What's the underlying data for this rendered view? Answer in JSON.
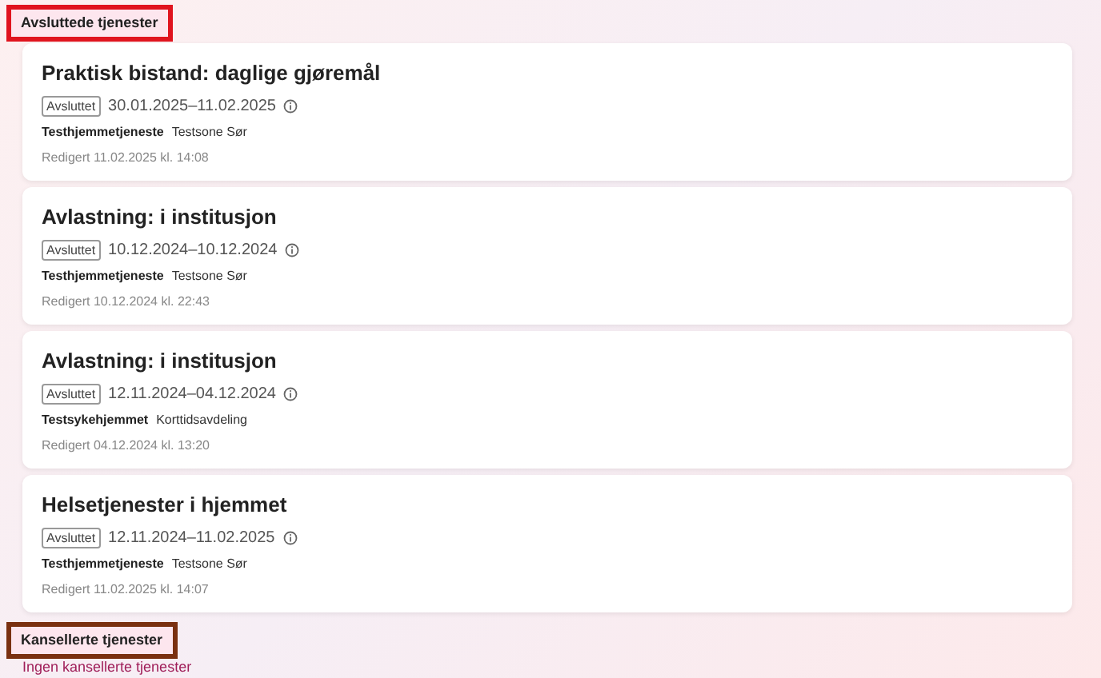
{
  "sections": [
    {
      "heading": "Avsluttede tjenester",
      "color": "#e0141e",
      "services": [
        {
          "title": "Praktisk bistand: daglige gjøremål",
          "status": "Avsluttet",
          "period": "30.01.2025–11.02.2025",
          "provider": "Testhjemmetjeneste",
          "unit": "Testsone Sør",
          "edited": "Redigert 11.02.2025 kl. 14:08"
        },
        {
          "title": "Avlastning: i institusjon",
          "status": "Avsluttet",
          "period": "10.12.2024–10.12.2024",
          "provider": "Testhjemmetjeneste",
          "unit": "Testsone Sør",
          "edited": "Redigert 10.12.2024 kl. 22:43"
        },
        {
          "title": "Avlastning: i institusjon",
          "status": "Avsluttet",
          "period": "12.11.2024–04.12.2024",
          "provider": "Testsykehjemmet",
          "unit": "Korttidsavdeling",
          "edited": "Redigert 04.12.2024 kl. 13:20"
        },
        {
          "title": "Helsetjenester i hjemmet",
          "status": "Avsluttet",
          "period": "12.11.2024–11.02.2025",
          "provider": "Testhjemmetjeneste",
          "unit": "Testsone Sør",
          "edited": "Redigert 11.02.2025 kl. 14:07"
        }
      ]
    },
    {
      "heading": "Kansellerte tjenester",
      "color": "#7a3010",
      "empty_text": "Ingen kansellerte tjenester"
    }
  ]
}
